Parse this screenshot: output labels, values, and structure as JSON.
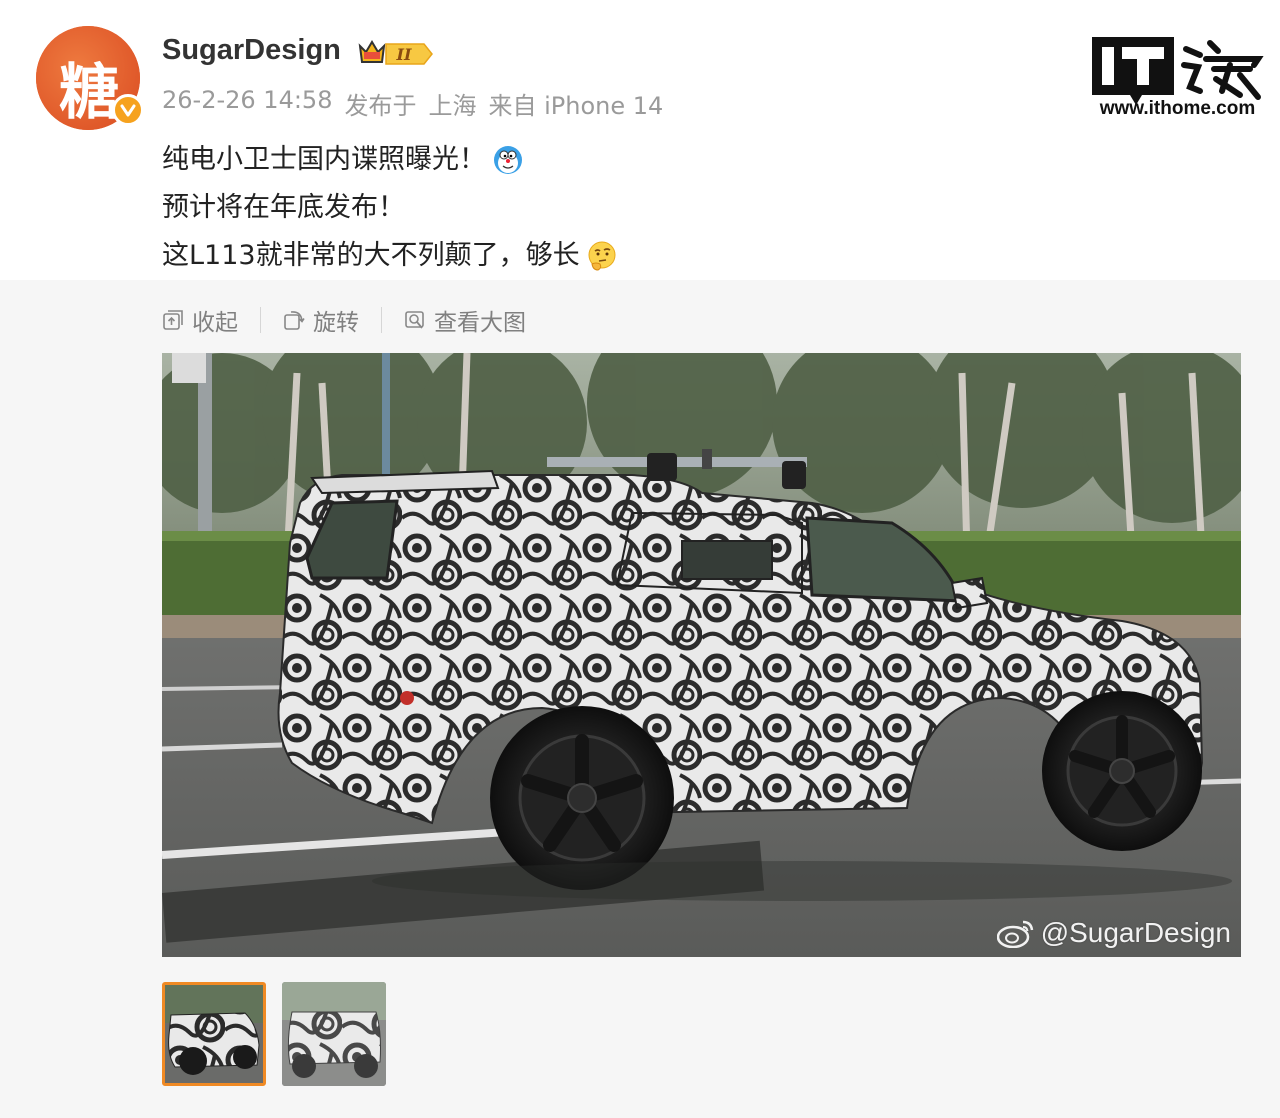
{
  "header": {
    "avatar_char": "糖",
    "username": "SugarDesign",
    "level_badge": "II",
    "timestamp": "26-2-26 14:58",
    "published_label": "发布于",
    "location": "上海",
    "source": "来自 iPhone 14"
  },
  "watermark_logo": {
    "brand_text": "IT之家",
    "url": "www.ithome.com"
  },
  "post": {
    "lines": [
      "纯电小卫士国内谍照曝光！",
      "预计将在年底发布！",
      "这L113就非常的大不列颠了，够长"
    ]
  },
  "toolbar": {
    "collapse_label": "收起",
    "rotate_label": "旋转",
    "view_large_label": "查看大图"
  },
  "photo": {
    "watermark": "@SugarDesign"
  },
  "thumbnails": {
    "count": 2,
    "selected_index": 1
  },
  "colors": {
    "avatar_bg": "#e4642b",
    "verify_badge": "#f6a21e",
    "thumb_selected_border": "#f08a24",
    "media_bg": "#f6f6f6"
  }
}
